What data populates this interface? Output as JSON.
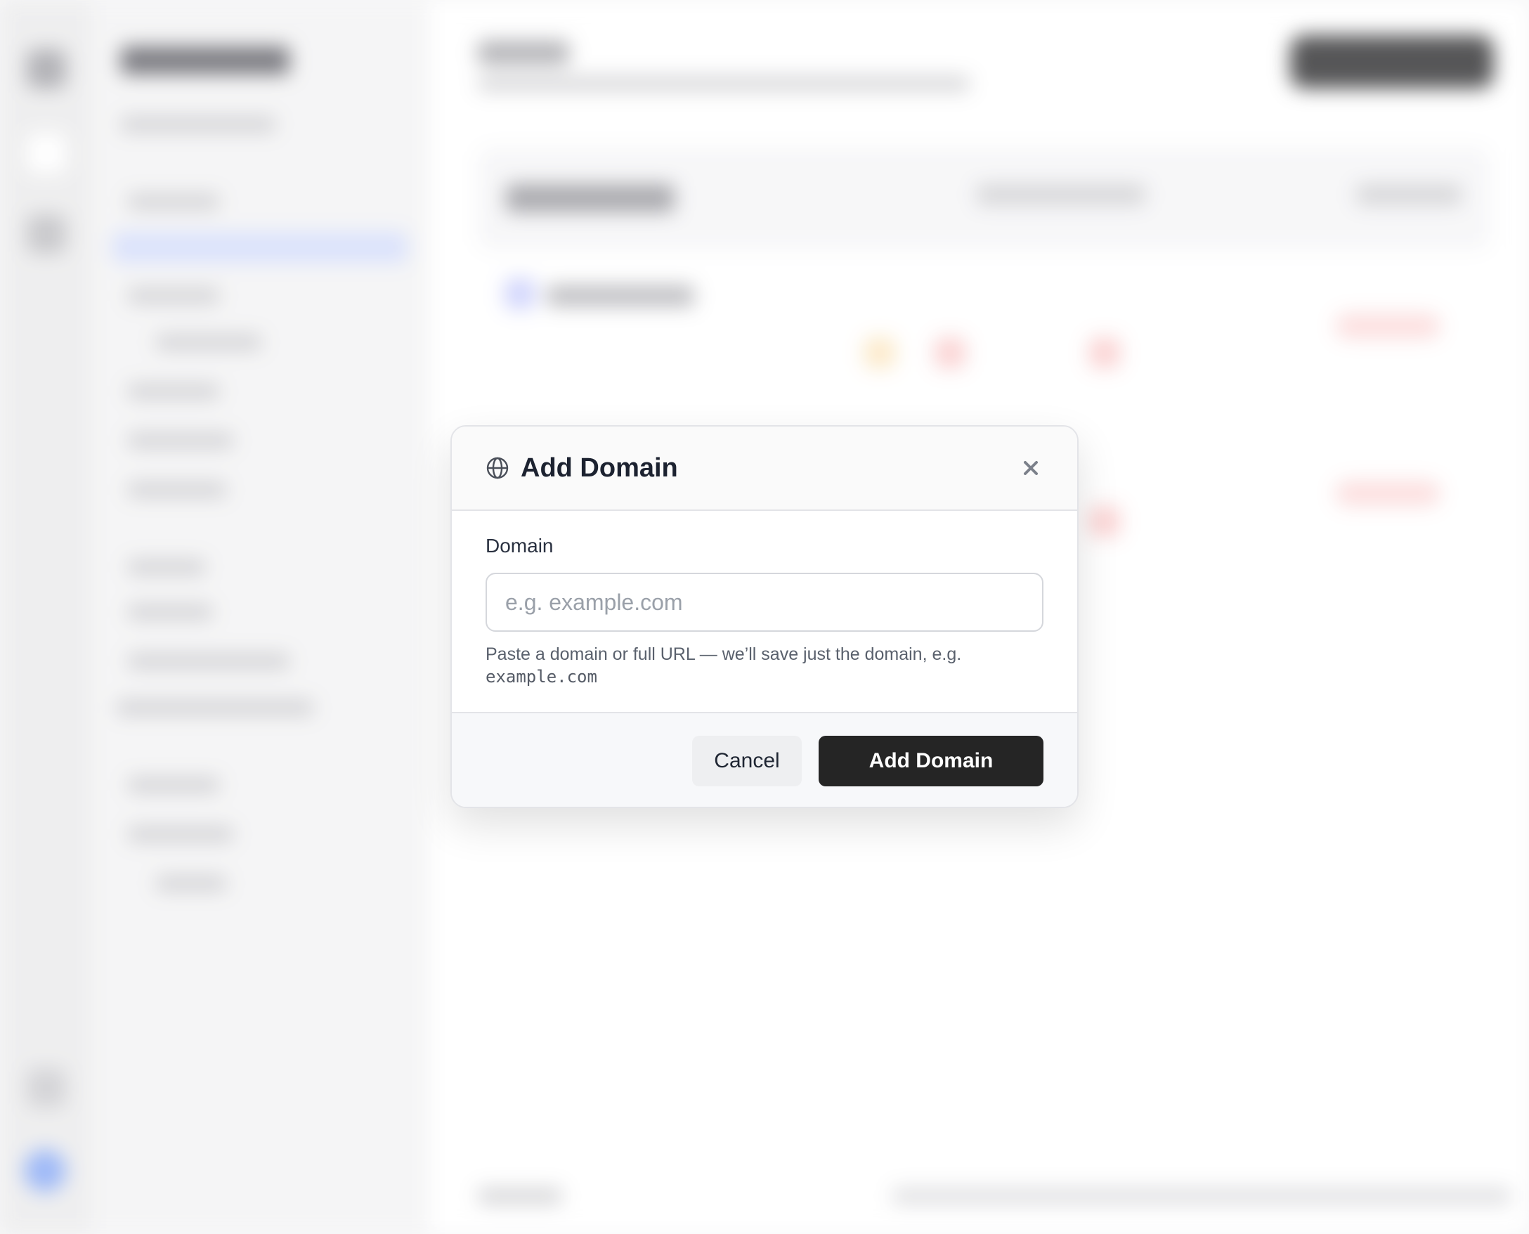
{
  "modal": {
    "title": "Add Domain",
    "header_icon": "globe-icon",
    "close_icon": "close-icon",
    "field_label": "Domain",
    "input_placeholder": "e.g. example.com",
    "input_value": "",
    "hint_text": "Paste a domain or full URL — we’ll save just the domain, e.g.",
    "hint_example": "example.com",
    "cancel_label": "Cancel",
    "submit_label": "Add Domain"
  },
  "colors": {
    "primary_button": "#252525",
    "cancel_button": "#eeeff1",
    "title_text": "#1c2230",
    "placeholder": "#9aa0a9"
  }
}
